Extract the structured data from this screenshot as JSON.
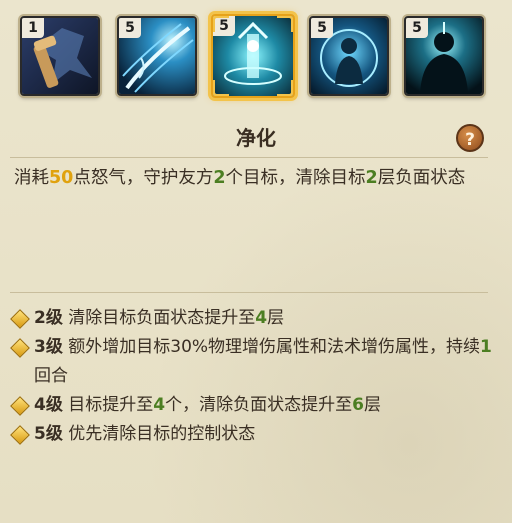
{
  "skills": [
    {
      "level": "1",
      "icon": "wrench-icon",
      "selected": false
    },
    {
      "level": "5",
      "icon": "wave-slash-icon",
      "selected": false
    },
    {
      "level": "5",
      "icon": "purify-pillar-icon",
      "selected": true
    },
    {
      "level": "5",
      "icon": "shield-figure-icon",
      "selected": false
    },
    {
      "level": "5",
      "icon": "shadow-figure-icon",
      "selected": false
    }
  ],
  "title": "净化",
  "help_icon": "?",
  "description": {
    "p1": "消耗",
    "rage": "50",
    "p2": "点怒气，守护友方",
    "targets": "2",
    "p3": "个目标，清除目标",
    "layers": "2",
    "p4": "层负面状态"
  },
  "upgrades": [
    {
      "lvl": "2级",
      "parts": [
        " 清除目标负面状态提升至",
        "4",
        "层"
      ]
    },
    {
      "lvl": "3级",
      "parts": [
        " 额外增加目标30%物理增伤属性和法术增伤属性，持续",
        "1",
        "回合"
      ]
    },
    {
      "lvl": "4级",
      "parts": [
        " 目标提升至",
        "4",
        "个，清除负面状态提升至",
        "6",
        "层"
      ]
    },
    {
      "lvl": "5级",
      "parts": [
        " 优先清除目标的控制状态"
      ]
    }
  ],
  "colors": {
    "accent_yellow": "#e0a20e",
    "accent_green": "#4c7e22",
    "selected_frame": "#f3c34a"
  }
}
